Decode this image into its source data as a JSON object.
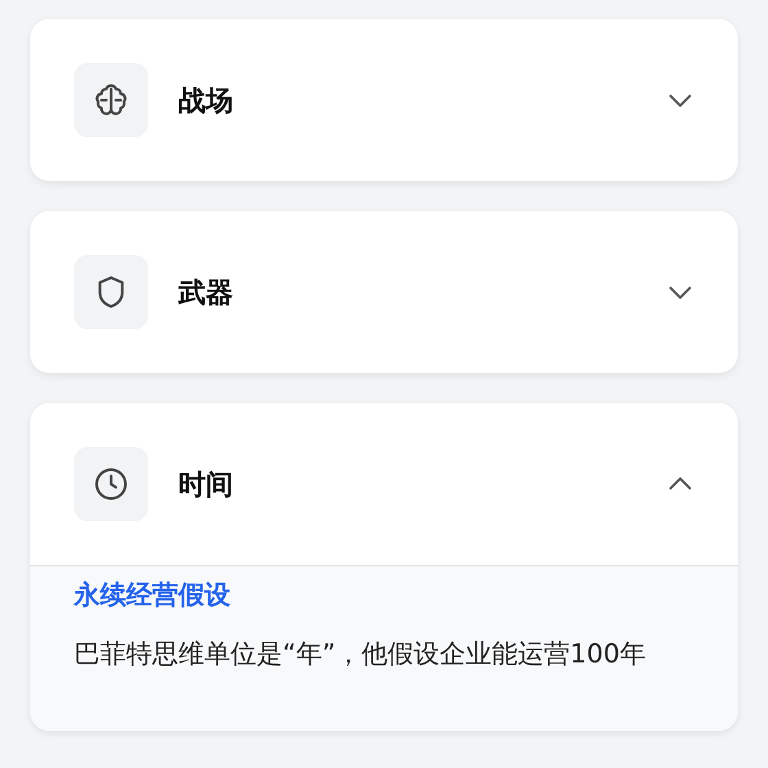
{
  "sections": [
    {
      "title": "战场",
      "expanded": false
    },
    {
      "title": "武器",
      "expanded": false
    },
    {
      "title": "时间",
      "expanded": true,
      "content": {
        "heading": "永续经营假设",
        "text": "巴菲特思维单位是“年”，他假设企业能运营100年"
      }
    }
  ]
}
